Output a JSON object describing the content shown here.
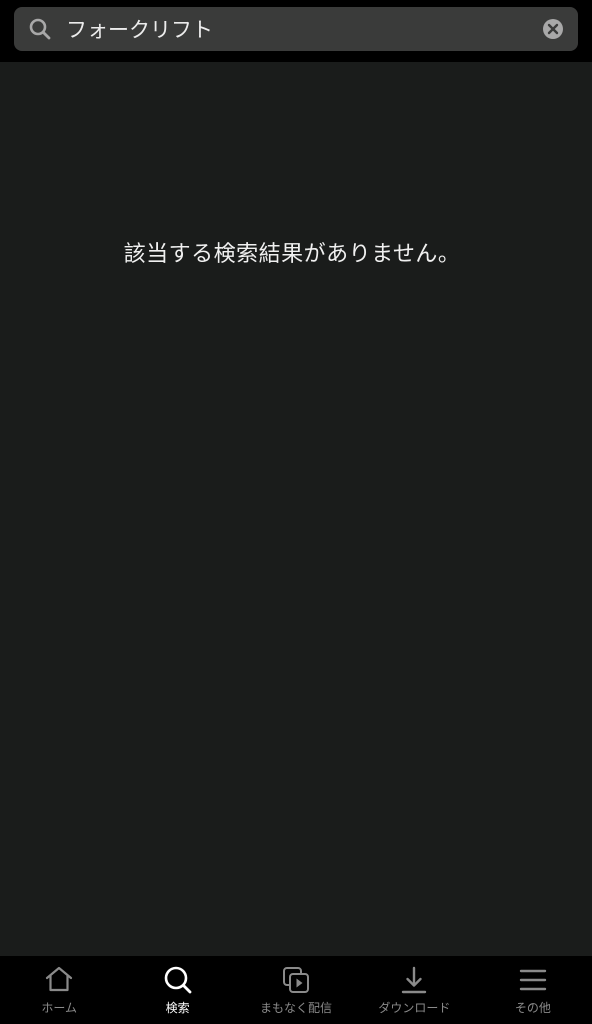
{
  "search": {
    "value": "フォークリフト",
    "placeholder": ""
  },
  "results": {
    "empty_message": "該当する検索結果がありません。"
  },
  "tab_bar": {
    "active_tab": "search",
    "tabs": [
      {
        "id": "home",
        "label": "ホーム",
        "icon": "home-icon"
      },
      {
        "id": "search",
        "label": "検索",
        "icon": "search-icon"
      },
      {
        "id": "coming_soon",
        "label": "まもなく配信",
        "icon": "play-stack-icon"
      },
      {
        "id": "downloads",
        "label": "ダウンロード",
        "icon": "download-icon"
      },
      {
        "id": "more",
        "label": "その他",
        "icon": "menu-icon"
      }
    ]
  },
  "colors": {
    "background": "#1a1c1b",
    "header_bg": "#000000",
    "search_field_bg": "#3a3b3a",
    "active_tab": "#ffffff",
    "inactive_tab": "#8a8a8a"
  }
}
